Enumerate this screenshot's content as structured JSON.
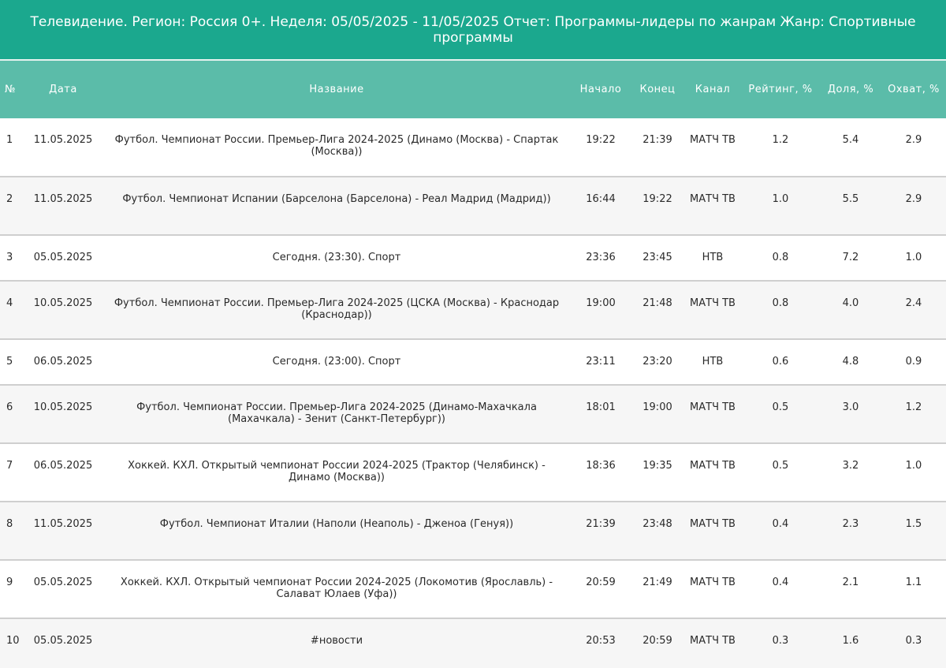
{
  "report": {
    "title": "Телевидение. Регион: Россия 0+. Неделя: 05/05/2025 - 11/05/2025 Отчет: Программы-лидеры по жанрам Жанр: Спортивные программы"
  },
  "table": {
    "headers": {
      "num": "№",
      "date": "Дата",
      "name": "Название",
      "start": "Начало",
      "end": "Конец",
      "channel": "Канал",
      "rating": "Рейтинг, %",
      "share": "Доля, %",
      "reach": "Охват, %"
    },
    "rows": [
      {
        "num": "1",
        "date": "11.05.2025",
        "name": "Футбол. Чемпионат России. Премьер-Лига 2024-2025 (Динамо (Москва) - Спартак (Москва))",
        "start": "19:22",
        "end": "21:39",
        "channel": "МАТЧ ТВ",
        "rating": "1.2",
        "share": "5.4",
        "reach": "2.9"
      },
      {
        "num": "2",
        "date": "11.05.2025",
        "name": "Футбол. Чемпионат Испании (Барселона (Барселона) - Реал Мадрид (Мадрид))",
        "start": "16:44",
        "end": "19:22",
        "channel": "МАТЧ ТВ",
        "rating": "1.0",
        "share": "5.5",
        "reach": "2.9"
      },
      {
        "num": "3",
        "date": "05.05.2025",
        "name": "Сегодня. (23:30). Спорт",
        "start": "23:36",
        "end": "23:45",
        "channel": "НТВ",
        "rating": "0.8",
        "share": "7.2",
        "reach": "1.0"
      },
      {
        "num": "4",
        "date": "10.05.2025",
        "name": "Футбол. Чемпионат России. Премьер-Лига 2024-2025 (ЦСКА (Москва) - Краснодар (Краснодар))",
        "start": "19:00",
        "end": "21:48",
        "channel": "МАТЧ ТВ",
        "rating": "0.8",
        "share": "4.0",
        "reach": "2.4"
      },
      {
        "num": "5",
        "date": "06.05.2025",
        "name": "Сегодня. (23:00). Спорт",
        "start": "23:11",
        "end": "23:20",
        "channel": "НТВ",
        "rating": "0.6",
        "share": "4.8",
        "reach": "0.9"
      },
      {
        "num": "6",
        "date": "10.05.2025",
        "name": "Футбол. Чемпионат России. Премьер-Лига 2024-2025 (Динамо-Махачкала (Махачкала) - Зенит (Санкт-Петербург))",
        "start": "18:01",
        "end": "19:00",
        "channel": "МАТЧ ТВ",
        "rating": "0.5",
        "share": "3.0",
        "reach": "1.2"
      },
      {
        "num": "7",
        "date": "06.05.2025",
        "name": "Хоккей. КХЛ. Открытый чемпионат России 2024-2025 (Трактор (Челябинск) - Динамо (Москва))",
        "start": "18:36",
        "end": "19:35",
        "channel": "МАТЧ ТВ",
        "rating": "0.5",
        "share": "3.2",
        "reach": "1.0"
      },
      {
        "num": "8",
        "date": "11.05.2025",
        "name": "Футбол. Чемпионат Италии (Наполи (Неаполь) - Дженоа (Генуя))",
        "start": "21:39",
        "end": "23:48",
        "channel": "МАТЧ ТВ",
        "rating": "0.4",
        "share": "2.3",
        "reach": "1.5"
      },
      {
        "num": "9",
        "date": "05.05.2025",
        "name": "Хоккей. КХЛ. Открытый чемпионат России 2024-2025 (Локомотив (Ярославль) - Салават Юлаев (Уфа))",
        "start": "20:59",
        "end": "21:49",
        "channel": "МАТЧ ТВ",
        "rating": "0.4",
        "share": "2.1",
        "reach": "1.1"
      },
      {
        "num": "10",
        "date": "05.05.2025",
        "name": "#новости",
        "start": "20:53",
        "end": "20:59",
        "channel": "МАТЧ ТВ",
        "rating": "0.3",
        "share": "1.6",
        "reach": "0.3"
      }
    ]
  }
}
